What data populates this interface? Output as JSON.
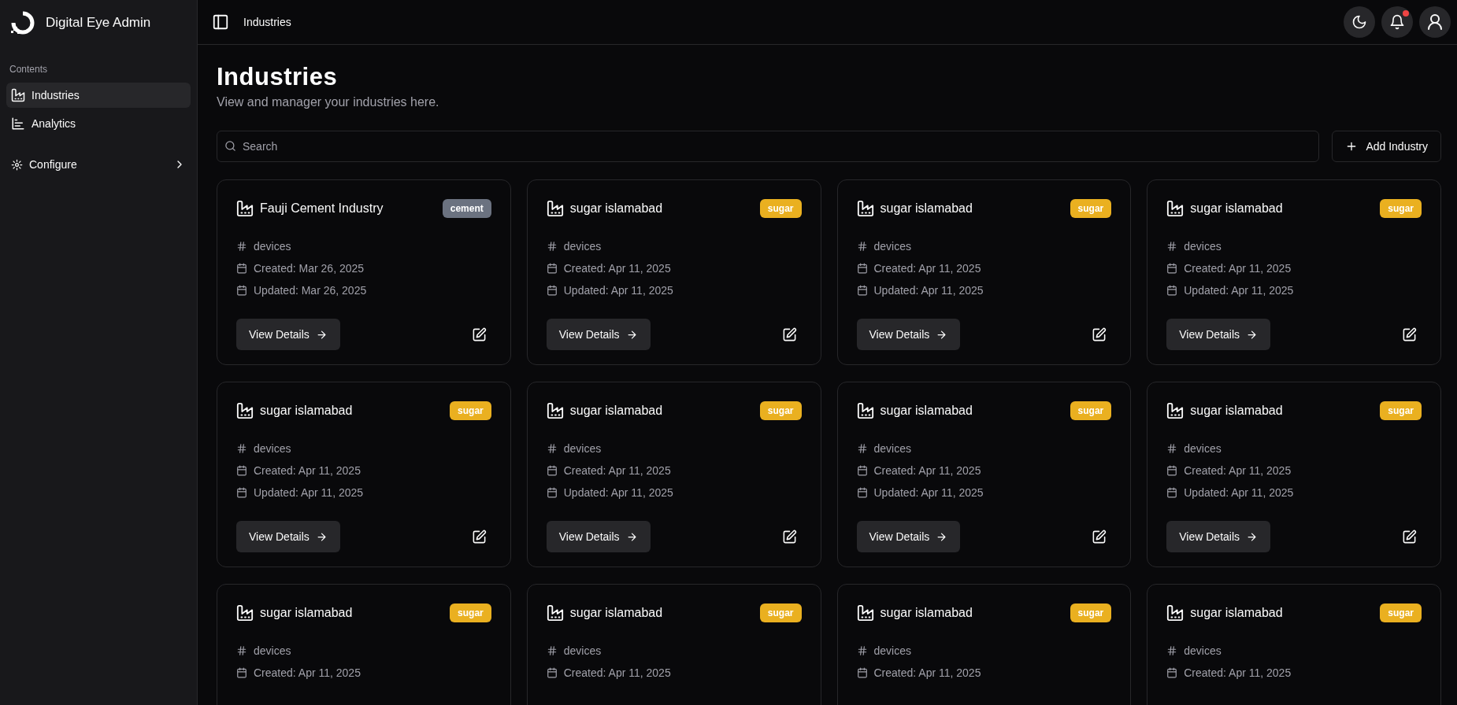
{
  "sidebar": {
    "brand": "Digital Eye Admin",
    "section_label": "Contents",
    "items": [
      {
        "label": "Industries",
        "selected": true
      },
      {
        "label": "Analytics",
        "selected": false
      }
    ],
    "configure": {
      "label": "Configure",
      "expanded": false
    }
  },
  "header": {
    "breadcrumb": "Industries",
    "notification_dot": true
  },
  "page": {
    "title": "Industries",
    "subtitle": "View and manager your industries here."
  },
  "search": {
    "placeholder": "Search"
  },
  "add_button": {
    "label": "Add Industry"
  },
  "industries": [
    {
      "name": "Fauji Cement Industry",
      "tag": "cement",
      "color": "#6b7280",
      "devices": "devices",
      "created": "Created: Mar 26, 2025",
      "updated": "Updated: Mar 26, 2025",
      "action": "View Details"
    },
    {
      "name": "sugar islamabad",
      "tag": "sugar",
      "color": "#eab020",
      "devices": "devices",
      "created": "Created: Apr 11, 2025",
      "updated": "Updated: Apr 11, 2025",
      "action": "View Details"
    },
    {
      "name": "sugar islamabad",
      "tag": "sugar",
      "color": "#eab020",
      "devices": "devices",
      "created": "Created: Apr 11, 2025",
      "updated": "Updated: Apr 11, 2025",
      "action": "View Details"
    },
    {
      "name": "sugar islamabad",
      "tag": "sugar",
      "color": "#eab020",
      "devices": "devices",
      "created": "Created: Apr 11, 2025",
      "updated": "Updated: Apr 11, 2025",
      "action": "View Details"
    },
    {
      "name": "sugar islamabad",
      "tag": "sugar",
      "color": "#eab020",
      "devices": "devices",
      "created": "Created: Apr 11, 2025",
      "updated": "Updated: Apr 11, 2025",
      "action": "View Details"
    },
    {
      "name": "sugar islamabad",
      "tag": "sugar",
      "color": "#eab020",
      "devices": "devices",
      "created": "Created: Apr 11, 2025",
      "updated": "Updated: Apr 11, 2025",
      "action": "View Details"
    },
    {
      "name": "sugar islamabad",
      "tag": "sugar",
      "color": "#eab020",
      "devices": "devices",
      "created": "Created: Apr 11, 2025",
      "updated": "Updated: Apr 11, 2025",
      "action": "View Details"
    },
    {
      "name": "sugar islamabad",
      "tag": "sugar",
      "color": "#eab020",
      "devices": "devices",
      "created": "Created: Apr 11, 2025",
      "updated": "Updated: Apr 11, 2025",
      "action": "View Details"
    },
    {
      "name": "sugar islamabad",
      "tag": "sugar",
      "color": "#eab020",
      "devices": "devices",
      "created": "Created: Apr 11, 2025"
    },
    {
      "name": "sugar islamabad",
      "tag": "sugar",
      "color": "#eab020",
      "devices": "devices",
      "created": "Created: Apr 11, 2025"
    },
    {
      "name": "sugar islamabad",
      "tag": "sugar",
      "color": "#eab020",
      "devices": "devices",
      "created": "Created: Apr 11, 2025"
    },
    {
      "name": "sugar islamabad",
      "tag": "sugar",
      "color": "#eab020",
      "devices": "devices",
      "created": "Created: Apr 11, 2025"
    }
  ]
}
